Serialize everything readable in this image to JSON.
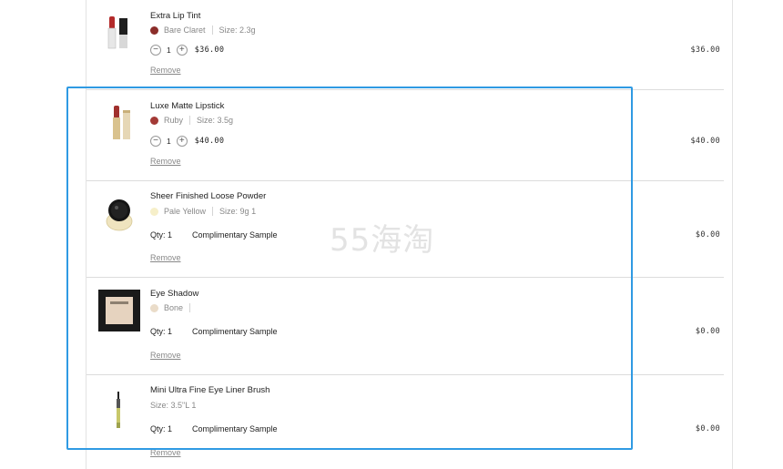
{
  "cart": {
    "items": [
      {
        "name": "Extra Lip Tint",
        "shade": "Bare Claret",
        "shade_color": "#8b2d2a",
        "size": "Size: 2.3g",
        "qty": "1",
        "unit_price": "$36.00",
        "total": "$36.00",
        "remove": "Remove"
      },
      {
        "name": "Luxe Matte Lipstick",
        "shade": "Ruby",
        "shade_color": "#a33a36",
        "size": "Size: 3.5g",
        "qty": "1",
        "unit_price": "$40.00",
        "total": "$40.00",
        "remove": "Remove"
      },
      {
        "name": "Sheer Finished Loose Powder",
        "shade": "Pale Yellow",
        "shade_color": "#f6efc9",
        "size": "Size: 9g 1",
        "qty_label": "Qty: 1",
        "note": "Complimentary Sample",
        "total": "$0.00",
        "remove": "Remove"
      },
      {
        "name": "Eye Shadow",
        "shade": "Bone",
        "shade_color": "#eadcc9",
        "qty_label": "Qty: 1",
        "note": "Complimentary Sample",
        "total": "$0.00",
        "remove": "Remove"
      },
      {
        "name": "Mini Ultra Fine Eye Liner Brush",
        "size": "Size: 3.5\"L 1",
        "qty_label": "Qty: 1",
        "note": "Complimentary Sample",
        "total": "$0.00",
        "remove": "Remove"
      }
    ]
  },
  "watermark": "55海淘",
  "highlight_color": "#2f9ae3"
}
